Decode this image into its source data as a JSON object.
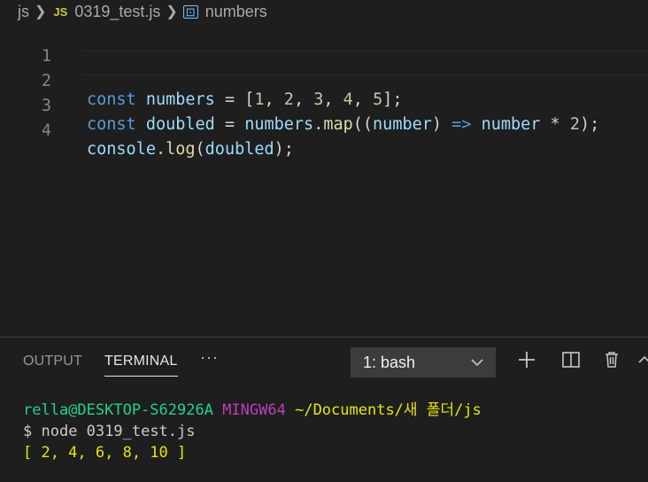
{
  "breadcrumb": {
    "folder": "js",
    "file_badge": "JS",
    "file": "0319_test.js",
    "symbol_icon": "symbol-variable-icon",
    "symbol": "numbers"
  },
  "editor": {
    "lines": [
      {
        "number": "1"
      },
      {
        "number": "2",
        "tokens": [
          "const",
          "numbers",
          "=",
          "[",
          "1",
          "2",
          "3",
          "4",
          "5",
          "];"
        ]
      },
      {
        "number": "3",
        "tokens": [
          "const",
          "doubled",
          "=",
          "numbers",
          ".",
          "map",
          "((",
          "number",
          ")",
          "=>",
          "number",
          "*",
          "2",
          ");"
        ]
      },
      {
        "number": "4",
        "tokens": [
          "console",
          ".",
          "log",
          "(",
          "doubled",
          ");"
        ]
      }
    ]
  },
  "panel": {
    "tabs": [
      "OUTPUT",
      "TERMINAL"
    ],
    "active_tab": "TERMINAL",
    "more_label": "···",
    "terminal_select": "1: bash",
    "actions": [
      "add-terminal-icon",
      "split-terminal-icon",
      "trash-icon",
      "chevron-up-icon"
    ]
  },
  "terminal": {
    "user_host": "rella@DESKTOP-S62926A",
    "env": "MINGW64",
    "path": "~/Documents/새 폴더/js",
    "prompt": "$",
    "command": "node 0319_test.js",
    "output": "[ 2, 4, 6, 8, 10 ]"
  },
  "colors": {
    "background": "#1e1e1e",
    "keyword": "#569cd6",
    "variable": "#9cdcfe",
    "function": "#dcdcaa",
    "number": "#b5cea8",
    "terminal_green": "#23d18b",
    "terminal_magenta": "#bc3fbc",
    "terminal_yellow": "#e5e510"
  }
}
